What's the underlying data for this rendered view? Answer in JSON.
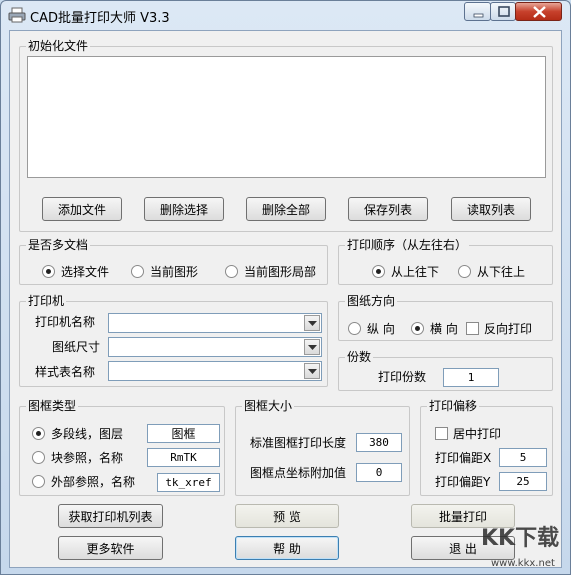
{
  "window": {
    "title": "CAD批量打印大师 V3.3"
  },
  "files_group": {
    "title": "初始化文件",
    "buttons": {
      "add": "添加文件",
      "delete_selected": "删除选择",
      "delete_all": "删除全部",
      "save_list": "保存列表",
      "load_list": "读取列表"
    }
  },
  "multi_doc_group": {
    "title": "是否多文档",
    "options": [
      {
        "label": "选择文件",
        "selected": true
      },
      {
        "label": "当前图形",
        "selected": false
      },
      {
        "label": "当前图形局部",
        "selected": false
      }
    ]
  },
  "print_order_group": {
    "title": "打印顺序（从左往右）",
    "options": [
      {
        "label": "从上往下",
        "selected": true
      },
      {
        "label": "从下往上",
        "selected": false
      }
    ]
  },
  "printer_group": {
    "title": "打印机",
    "printer_name_label": "打印机名称",
    "paper_size_label": "图纸尺寸",
    "style_table_label": "样式表名称"
  },
  "orientation_group": {
    "title": "图纸方向",
    "portrait": "纵 向",
    "landscape": "横 向",
    "reverse": "反向打印",
    "landscape_selected": true
  },
  "copies_group": {
    "title": "份数",
    "label": "打印份数",
    "value": "1"
  },
  "frame_type_group": {
    "title": "图框类型",
    "options": [
      {
        "label": "多段线，图层",
        "value": "图框",
        "selected": true
      },
      {
        "label": "块参照，名称",
        "value": "RmTK",
        "selected": false
      },
      {
        "label": "外部参照，名称",
        "value": "tk_xref",
        "selected": false
      }
    ]
  },
  "frame_size_group": {
    "title": "图框大小",
    "std_length_label": "标准图框打印长度",
    "std_length_value": "380",
    "coord_add_label": "图框点坐标附加值",
    "coord_add_value": "0"
  },
  "offset_group": {
    "title": "打印偏移",
    "center_label": "居中打印",
    "x_label": "打印偏距X",
    "x_value": "5",
    "y_label": "打印偏距Y",
    "y_value": "25"
  },
  "bottom_buttons": {
    "get_printers": "获取打印机列表",
    "preview": "预 览",
    "batch_print": "批量打印",
    "more_software": "更多软件",
    "help": "帮 助",
    "exit": "退 出"
  },
  "watermark": {
    "text": "KK下载",
    "url": "www.kkx.net"
  },
  "colors": {
    "close_red": "#c7412c",
    "focus_blue": "#3c7fb1"
  }
}
